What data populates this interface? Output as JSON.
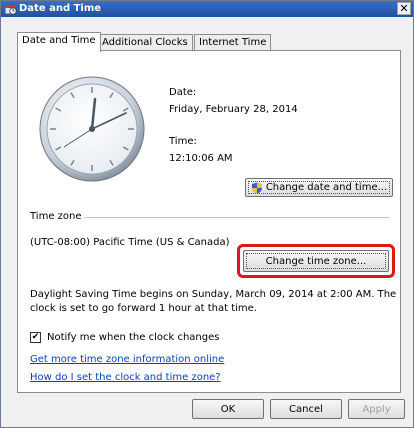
{
  "window": {
    "title": "Date and Time",
    "close_symbol": "✕"
  },
  "tabs": [
    {
      "label": "Date and Time",
      "active": true
    },
    {
      "label": "Additional Clocks",
      "active": false
    },
    {
      "label": "Internet Time",
      "active": false
    }
  ],
  "datetime": {
    "date_label": "Date:",
    "date_value": "Friday, February 28, 2014",
    "time_label": "Time:",
    "time_value": "12:10:06 AM",
    "change_datetime_button": "Change date and time..."
  },
  "timezone": {
    "section_label": "Time zone",
    "value": "(UTC-08:00) Pacific Time (US & Canada)",
    "change_button": "Change time zone...",
    "dst_line1": "Daylight Saving Time begins on Sunday, March 09, 2014 at 2:00 AM. The",
    "dst_line2": "clock is set to go forward 1 hour at that time.",
    "notify_label": "Notify me when the clock changes",
    "notify_checked": true,
    "link_more_info": "Get more time zone information online",
    "link_how_to": "How do I set the clock and time zone?"
  },
  "footer": {
    "ok": "OK",
    "cancel": "Cancel",
    "apply": "Apply"
  },
  "icons": {
    "window_icon": "date-time-icon",
    "shield_icon": "uac-shield-icon",
    "clock_icon": "analog-clock-icon"
  },
  "colors": {
    "highlight": "#e0161f",
    "link": "#0645ad",
    "titlebar": "#1f4fa3"
  }
}
